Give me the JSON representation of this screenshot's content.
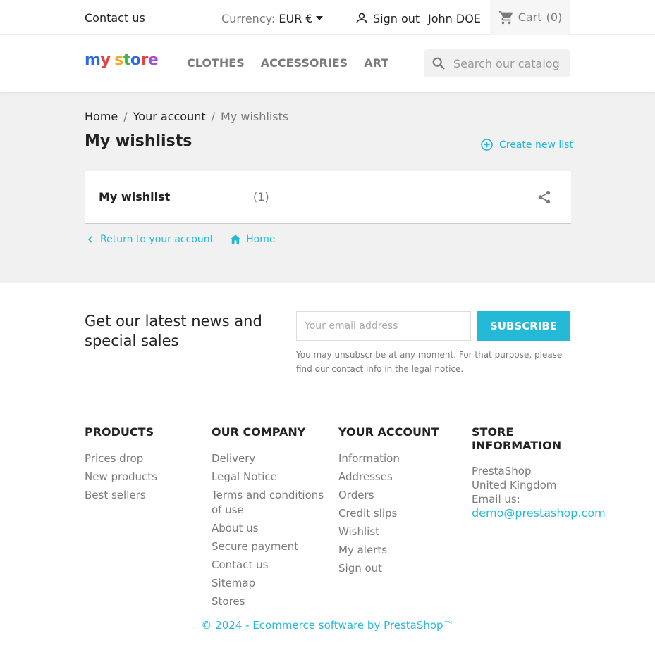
{
  "topbar": {
    "contact": "Contact us",
    "currency_label": "Currency:",
    "currency_value": "EUR €",
    "sign_out": "Sign out",
    "user_name": "John DOE",
    "cart": "Cart",
    "cart_count": "(0)"
  },
  "header": {
    "logo_text": "my store",
    "nav": [
      "CLOTHES",
      "ACCESSORIES",
      "ART"
    ],
    "search_placeholder": "Search our catalog"
  },
  "breadcrumb": {
    "items": [
      "Home",
      "Your account",
      "My wishlists"
    ],
    "separator": "/"
  },
  "page": {
    "title": "My wishlists",
    "create_new_list": "Create new list"
  },
  "wishlists": [
    {
      "name": "My wishlist",
      "count": "(1)"
    }
  ],
  "account_links": {
    "return": "Return to your account",
    "home": "Home"
  },
  "newsletter": {
    "title": "Get our latest news and special sales",
    "email_placeholder": "Your email address",
    "subscribe": "SUBSCRIBE",
    "note": "You may unsubscribe at any moment. For that purpose, please find our contact info in the legal notice."
  },
  "footer": {
    "products": {
      "title": "PRODUCTS",
      "items": [
        "Prices drop",
        "New products",
        "Best sellers"
      ]
    },
    "company": {
      "title": "OUR COMPANY",
      "items": [
        "Delivery",
        "Legal Notice",
        "Terms and conditions of use",
        "About us",
        "Secure payment",
        "Contact us",
        "Sitemap",
        "Stores"
      ]
    },
    "account": {
      "title": "YOUR ACCOUNT",
      "items": [
        "Information",
        "Addresses",
        "Orders",
        "Credit slips",
        "Wishlist",
        "My alerts",
        "Sign out"
      ]
    },
    "store": {
      "title": "STORE INFORMATION",
      "name": "PrestaShop",
      "country": "United Kingdom",
      "email_label": "Email us:",
      "email": "demo@prestashop.com"
    },
    "copyright": "© 2024 - Ecommerce software by PrestaShop™"
  },
  "colors": {
    "accent": "#24b9d7",
    "text": "#232323",
    "muted": "#7a7a7a",
    "bg_gray": "#f1f1f1"
  }
}
